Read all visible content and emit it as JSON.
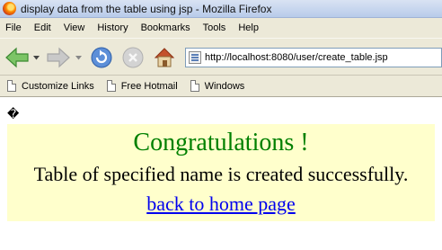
{
  "window": {
    "title": "display data from the table using jsp - Mozilla Firefox"
  },
  "menu": [
    "File",
    "Edit",
    "View",
    "History",
    "Bookmarks",
    "Tools",
    "Help"
  ],
  "toolbar": {
    "back_icon": "back-arrow-icon",
    "forward_icon": "forward-arrow-icon",
    "reload_icon": "reload-icon",
    "stop_icon": "stop-icon",
    "home_icon": "home-icon"
  },
  "address": {
    "url": "http://localhost:8080/user/create_table.jsp"
  },
  "bookmarks": [
    "Customize Links",
    "Free Hotmail",
    "Windows"
  ],
  "content": {
    "glyph": "�",
    "heading": "Congratulations !",
    "message": "Table of specified name is created successfully.",
    "link": "back to home page"
  },
  "colors": {
    "panel_bg": "#ffffcc",
    "heading": "#008000",
    "link": "#0000ee"
  }
}
